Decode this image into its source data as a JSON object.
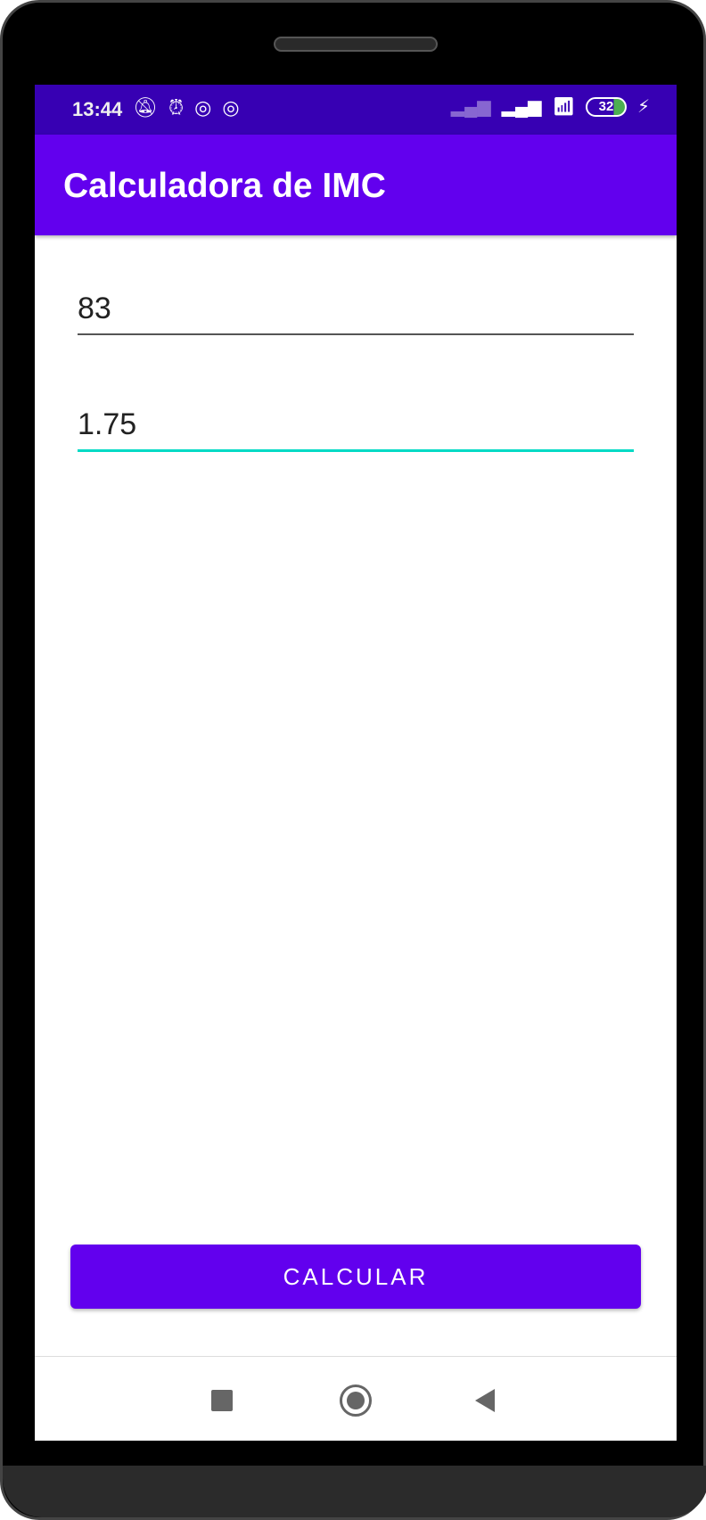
{
  "status_bar": {
    "time": "13:44",
    "battery": "32",
    "icons": [
      "bell-off-icon",
      "alarm-icon",
      "app-notification-icon",
      "app-notification-icon",
      "signal-off-icon",
      "roaming-signal-icon",
      "wifi-icon",
      "battery-icon",
      "charging-icon"
    ]
  },
  "app_bar": {
    "title": "Calculadora de IMC"
  },
  "form": {
    "weight_value": "83",
    "height_value": "1.75"
  },
  "button": {
    "label": "CALCULAR"
  },
  "colors": {
    "primary": "#6200EE",
    "primary_dark": "#3700B3",
    "accent": "#03DAC5"
  }
}
